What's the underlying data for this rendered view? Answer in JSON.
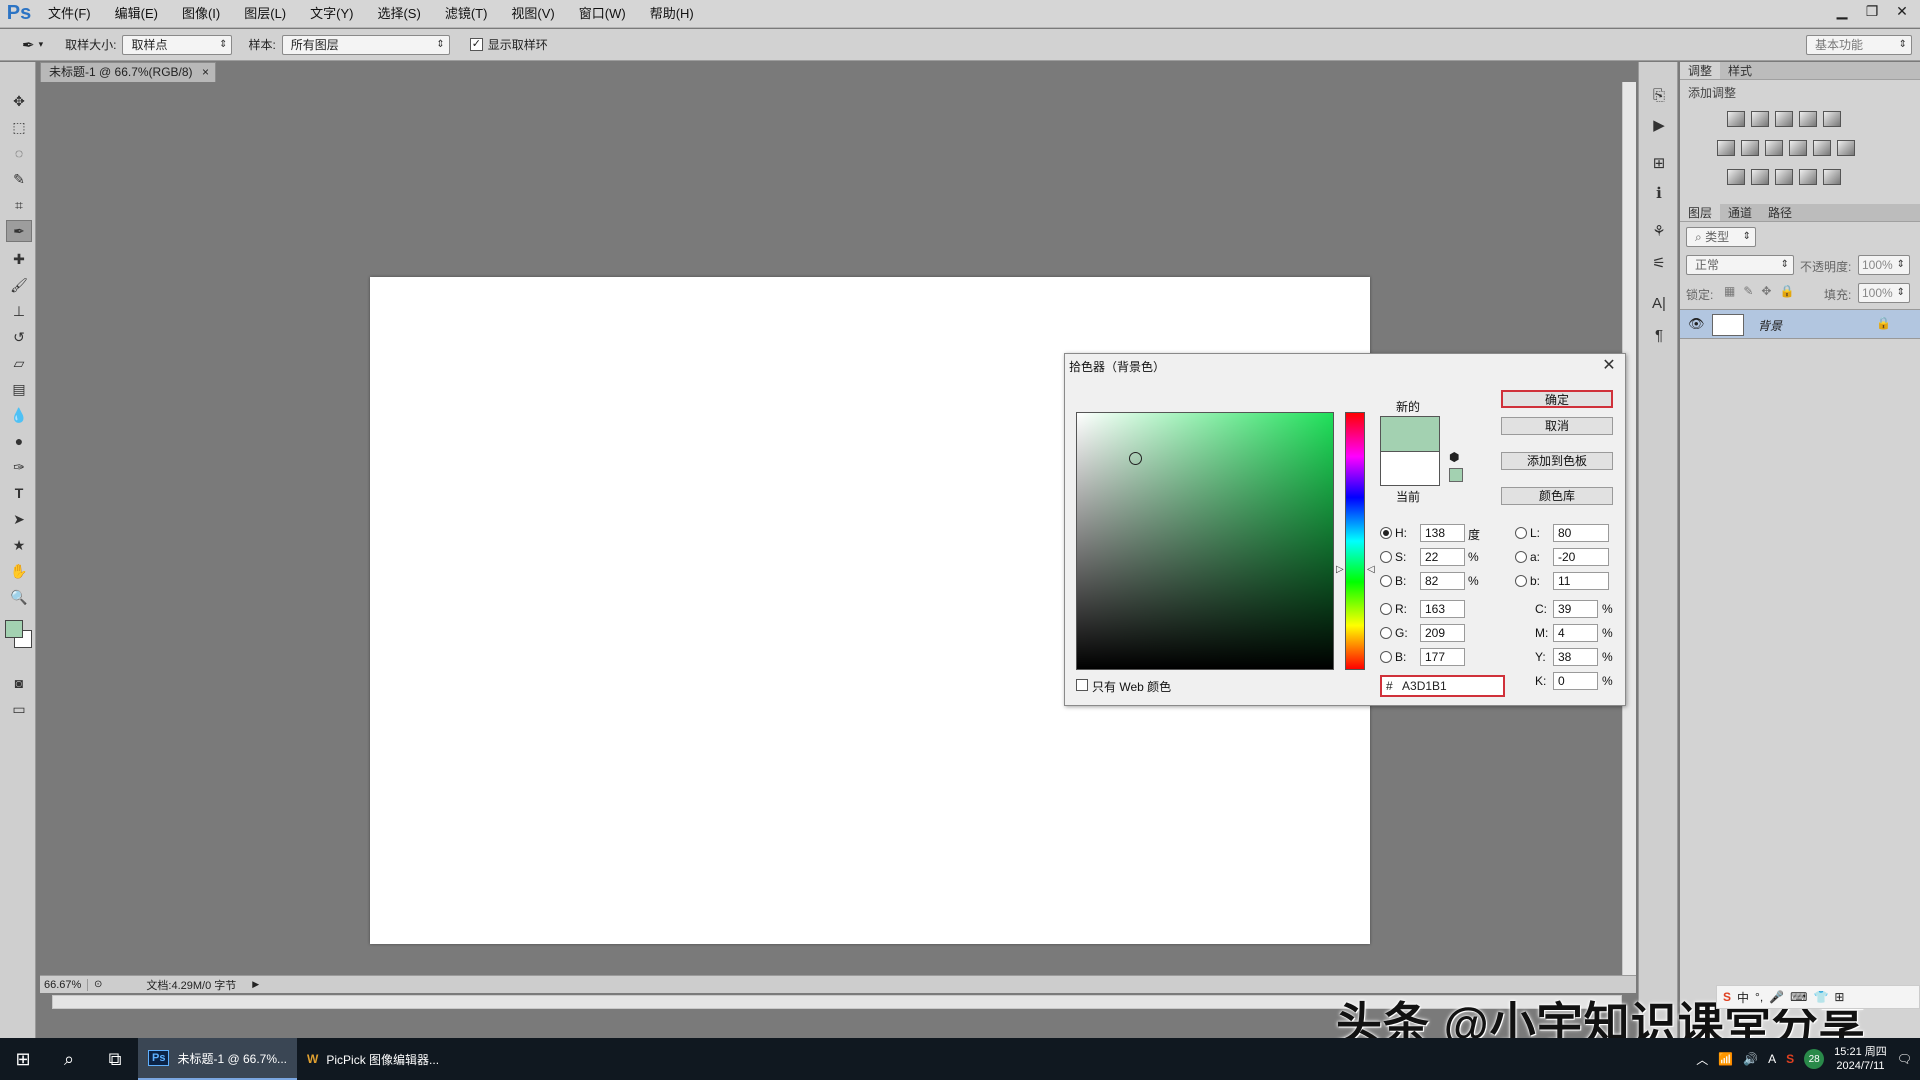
{
  "app": {
    "logo": "Ps"
  },
  "menu": [
    "文件(F)",
    "编辑(E)",
    "图像(I)",
    "图层(L)",
    "文字(Y)",
    "选择(S)",
    "滤镜(T)",
    "视图(V)",
    "窗口(W)",
    "帮助(H)"
  ],
  "options": {
    "sample_size_label": "取样大小:",
    "sample_size_value": "取样点",
    "sample_label": "样本:",
    "sample_value": "所有图层",
    "show_ring_label": "显示取样环",
    "workspace": "基本功能"
  },
  "document": {
    "tab_title": "未标题-1 @ 66.7%(RGB/8)",
    "zoom": "66.67%",
    "doc_info": "文档:4.29M/0 字节"
  },
  "colors": {
    "foreground": "#A3D1B1",
    "background": "#ffffff",
    "new_color": "#A3D1B1"
  },
  "adjust_panel": {
    "tabs": [
      "调整",
      "样式"
    ],
    "add_label": "添加调整"
  },
  "layers_panel": {
    "tabs": [
      "图层",
      "通道",
      "路径"
    ],
    "kind_filter": "类型",
    "blend_mode": "正常",
    "opacity_label": "不透明度:",
    "opacity_value": "100%",
    "lock_label": "锁定:",
    "fill_label": "填充:",
    "fill_value": "100%",
    "layer_name": "背景"
  },
  "dialog": {
    "title": "拾色器（背景色）",
    "new_label": "新的",
    "current_label": "当前",
    "ok": "确定",
    "cancel": "取消",
    "add_swatch": "添加到色板",
    "color_libraries": "颜色库",
    "web_only": "只有 Web 颜色",
    "hsb": {
      "h_label": "H:",
      "h": "138",
      "h_unit": "度",
      "s_label": "S:",
      "s": "22",
      "s_unit": "%",
      "b_label": "B:",
      "b": "82",
      "b_unit": "%"
    },
    "rgb": {
      "r_label": "R:",
      "r": "163",
      "g_label": "G:",
      "g": "209",
      "b_label": "B:",
      "b": "177"
    },
    "lab": {
      "l_label": "L:",
      "l": "80",
      "a_label": "a:",
      "a": "-20",
      "b_label": "b:",
      "b": "11"
    },
    "cmyk": {
      "c_label": "C:",
      "c": "39",
      "m_label": "M:",
      "m": "4",
      "y_label": "Y:",
      "y": "38",
      "k_label": "K:",
      "k": "0",
      "unit": "%"
    },
    "hex_label": "#",
    "hex": "A3D1B1"
  },
  "taskbar": {
    "app1": "未标题-1 @ 66.7%...",
    "app2": "PicPick 图像编辑器...",
    "time": "15:21 周四",
    "date": "2024/7/11",
    "notif_count": "28"
  },
  "watermark": "头条 @小宇知识课堂分享"
}
